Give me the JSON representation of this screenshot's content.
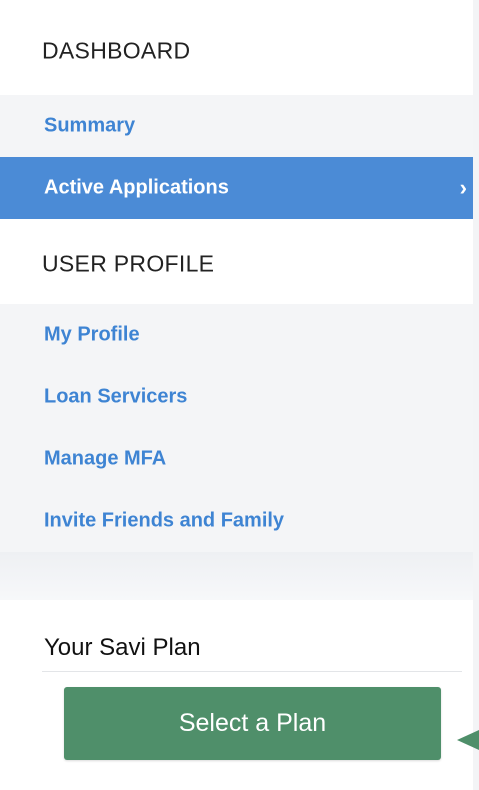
{
  "dashboard": {
    "title": "DASHBOARD",
    "items": [
      {
        "label": "Summary",
        "active": false
      },
      {
        "label": "Active Applications",
        "active": true
      }
    ]
  },
  "user_profile": {
    "title": "USER PROFILE",
    "items": [
      {
        "label": "My Profile"
      },
      {
        "label": "Loan Servicers"
      },
      {
        "label": "Manage MFA"
      },
      {
        "label": "Invite Friends and Family"
      }
    ]
  },
  "plan": {
    "title": "Your Savi Plan",
    "button_label": "Select a Plan"
  },
  "icons": {
    "active_chevron": "chevron-right-icon",
    "pointer_arrow": "arrow-left-icon"
  },
  "colors": {
    "link": "#3e84d3",
    "active_bg": "#4b8bd6",
    "button": "#4f8f6a",
    "arrow": "#4f8f6a"
  }
}
